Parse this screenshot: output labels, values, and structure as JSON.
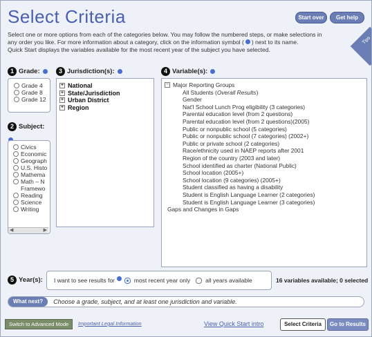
{
  "header": {
    "title": "Select Criteria",
    "start_over": "Start over",
    "get_help": "Get help"
  },
  "intro": {
    "line1": "Select one or more options from each of the categories below. You may follow the numbered steps, or make selections in",
    "line2": "any order you like. For more information about a category, click on the information symbol (",
    "line2b": ") next to its name.",
    "line3": "Quick Start displays the variables available for the most recent year of the subject you have selected."
  },
  "tips_label": "Tips",
  "grade": {
    "step": "1",
    "heading": "Grade:",
    "options": [
      "Grade 4",
      "Grade 8",
      "Grade 12"
    ]
  },
  "subject": {
    "step": "2",
    "heading": "Subject:",
    "options": [
      "Civics",
      "Economic",
      "Geograph",
      "U.S. Histo",
      "Mathema",
      "Math – N",
      "Framewo",
      "Reading",
      "Science",
      "Writing"
    ]
  },
  "jurisdiction": {
    "step": "3",
    "heading": "Jurisdiction(s):",
    "items": [
      "National",
      "State/Jurisdiction",
      "Urban District",
      "Region"
    ]
  },
  "variables": {
    "step": "4",
    "heading": "Variable(s):",
    "group": "Major Reporting Groups",
    "items": [
      "All Students (Overall Results)",
      "Gender",
      "Nat'l School Lunch Prog eligibility (3 categories)",
      "Parental education level (from 2 questions)",
      "Parental education level (from 2 questions)(2005)",
      "Public or nonpublic school (5 categories)",
      "Public or nonpublic school (7 categories) (2002+)",
      "Public or private school (2 categories)",
      "Race/ethnicity used in NAEP reports after 2001",
      "Region of the country (2003 and later)",
      "School identified as charter (National Public)",
      "School location (2005+)",
      "School location (9 categories) (2005+)",
      "Student classified as having a disability",
      "Student is English Language Learner (2 categories)",
      "Student is English Language Learner (3 categories)"
    ],
    "footer": "Gaps and Changes in Gaps"
  },
  "years": {
    "step": "5",
    "heading": "Year(s):",
    "prompt": "I want to see results for",
    "opt_recent": "most recent year only",
    "opt_all": "all years available",
    "status": "16 variables available; 0 selected"
  },
  "whatnext": {
    "button": "What next?",
    "text": "Choose a grade, subject, and at least one jurisdiction and variable."
  },
  "footer": {
    "advanced": "Switch to Advanced Mode",
    "legal": "Important Legal Information",
    "quickstart": "View Quick Start intro",
    "select_criteria": "Select Criteria",
    "go_results": "Go to Results"
  }
}
